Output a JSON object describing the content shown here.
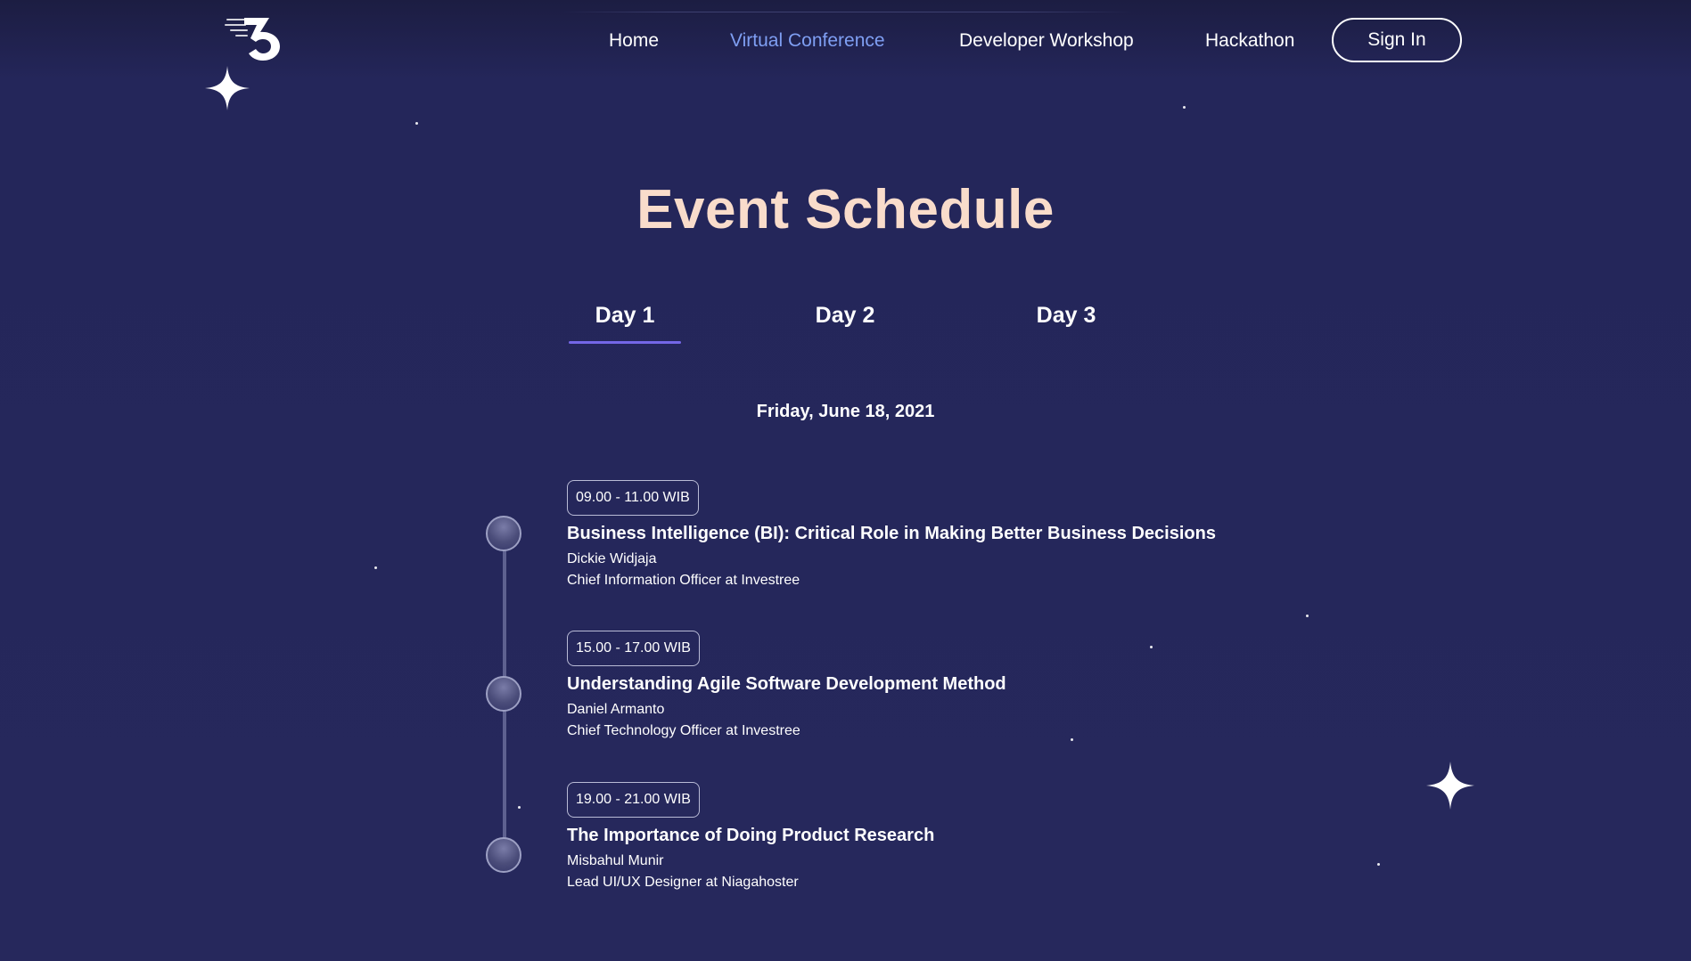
{
  "nav": {
    "items": [
      {
        "label": "Home"
      },
      {
        "label": "Virtual Conference"
      },
      {
        "label": "Developer Workshop"
      },
      {
        "label": "Hackathon"
      }
    ],
    "signin_label": "Sign In",
    "active_color": "#7f9ff3"
  },
  "page": {
    "title": "Event Schedule",
    "title_color": "#f9dccb",
    "background": "#25265a"
  },
  "tabs": {
    "items": [
      {
        "label": "Day 1"
      },
      {
        "label": "Day 2"
      },
      {
        "label": "Day 3"
      }
    ],
    "active": "Day 1",
    "underline_color": "#7467e6"
  },
  "schedule": {
    "date": "Friday, June 18, 2021",
    "sessions": [
      {
        "time": "09.00 - 11.00 WIB",
        "title": "Business Intelligence (BI): Critical Role in Making Better Business Decisions",
        "speaker": "Dickie Widjaja",
        "role": "Chief Information Officer at Investree"
      },
      {
        "time": "15.00 - 17.00 WIB",
        "title": "Understanding Agile Software Development Method",
        "speaker": "Daniel Armanto",
        "role": "Chief Technology Officer at Investree"
      },
      {
        "time": "19.00 - 21.00 WIB",
        "title": "The Importance of Doing Product Research",
        "speaker": "Misbahul Munir",
        "role": "Lead UI/UX Designer at Niagahoster"
      }
    ]
  },
  "icons": {
    "logo": "brand-logo-icon",
    "sparkle": "sparkle-star-icon"
  }
}
